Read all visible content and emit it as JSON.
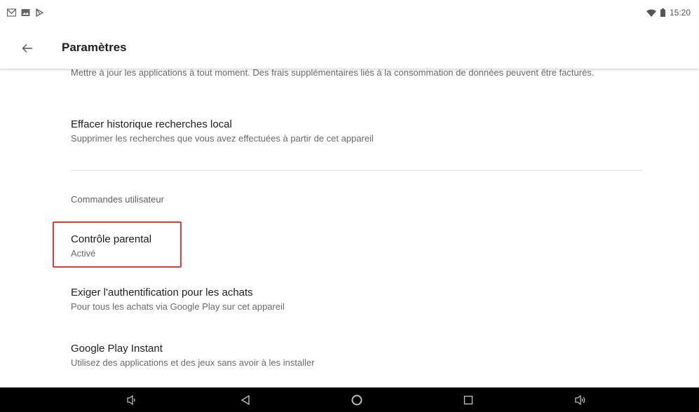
{
  "status_bar": {
    "left_icons": [
      "gmail-icon",
      "photo-icon",
      "play-store-icon"
    ],
    "time": "15:20",
    "right_icons": [
      "wifi-icon",
      "battery-icon"
    ]
  },
  "app_bar": {
    "back_icon": "arrow-left-icon",
    "title": "Paramètres"
  },
  "settings": {
    "auto_update_partial": {
      "subtitle": "Mettre à jour les applications à tout moment. Des frais supplémentaires liés à la consommation de données peuvent être facturés."
    },
    "clear_history": {
      "title": "Effacer historique recherches local",
      "subtitle": "Supprimer les recherches que vous avez effectuées à partir de cet appareil"
    },
    "user_controls_header": "Commandes utilisateur",
    "parental_control": {
      "title": "Contrôle parental",
      "subtitle": "Activé"
    },
    "purchase_auth": {
      "title": "Exiger l'authentification pour les achats",
      "subtitle": "Pour tous les achats via Google Play sur cet appareil"
    },
    "play_instant": {
      "title": "Google Play Instant",
      "subtitle": "Utilisez des applications et des jeux sans avoir à les installer"
    }
  },
  "nav_bar": {
    "buttons": [
      "volume-down-icon",
      "back-triangle-icon",
      "home-circle-icon",
      "recents-square-icon",
      "volume-up-icon"
    ]
  },
  "colors": {
    "highlight": "#e53935",
    "nav_bg": "#000000"
  }
}
